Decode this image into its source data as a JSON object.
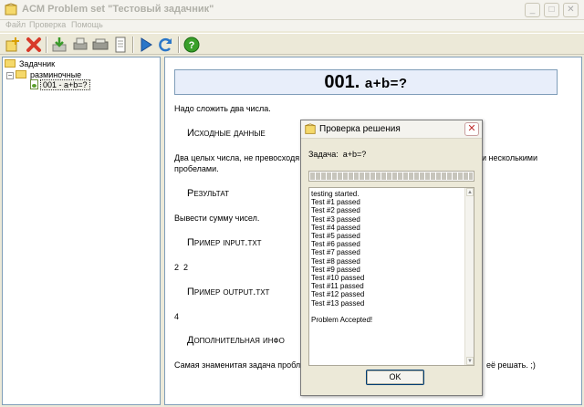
{
  "window": {
    "title": "ACM Problem set \"Тестовый задачник\"",
    "controls": [
      "minimize-icon",
      "maximize-icon",
      "close-icon"
    ]
  },
  "menu": {
    "items": [
      "Файл",
      "Проверка",
      "Помощь"
    ]
  },
  "toolbar": {
    "buttons": [
      "add-icon",
      "delete-icon",
      "import-icon",
      "print-icon",
      "print-preview-icon",
      "document-icon",
      "run-icon",
      "refresh-icon",
      "help-icon"
    ]
  },
  "tree": {
    "root": "Задачник",
    "group": "разминочные",
    "item": "001 - a+b=?"
  },
  "content": {
    "problem_code": "001.",
    "problem_name": "a+b=?",
    "statement": "Надо сложить два числа.",
    "input_heading": "Исходные данные",
    "input_text_left": "Два целых числа, не превосходя",
    "input_text_right": "и несколькими",
    "input_text_line2": "пробелами.",
    "output_heading": "Результат",
    "output_text": "Вывести сумму чисел.",
    "sample_input_heading": "Пример input.txt",
    "sample_input": "2  2",
    "sample_output_heading": "Пример output.txt",
    "sample_output": "4",
    "extra_heading": "Дополнительная инфо",
    "extra_text_left": "Самая знаменитая задача пробле",
    "extra_text_right": "её решать. ;)"
  },
  "dialog": {
    "title": "Проверка решения",
    "task_label": "Задача:",
    "task_value": "a+b=?",
    "progress_fraction": 1.0,
    "log": [
      "testing started.",
      "Test #1 passed",
      "Test #2 passed",
      "Test #3 passed",
      "Test #4 passed",
      "Test #5 passed",
      "Test #6 passed",
      "Test #7 passed",
      "Test #8 passed",
      "Test #9 passed",
      "Test #10 passed",
      "Test #11 passed",
      "Test #12 passed",
      "Test #13 passed",
      "",
      "Problem Accepted!"
    ],
    "ok_label": "OK"
  }
}
